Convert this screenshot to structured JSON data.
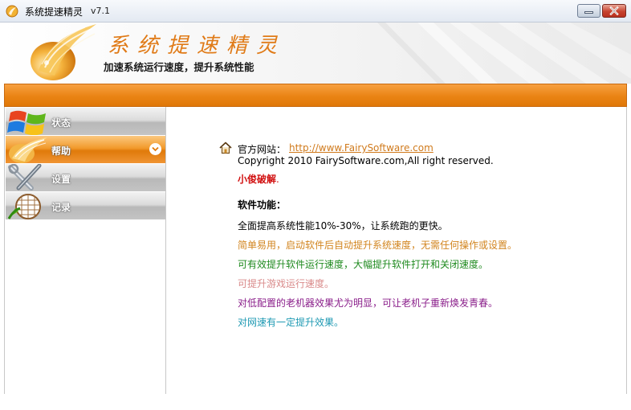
{
  "window": {
    "title": "系统提速精灵",
    "version": "v7.1"
  },
  "banner": {
    "title": "系统提速精灵",
    "subtitle": "加速系统运行速度，提升系统性能"
  },
  "sidebar": {
    "items": [
      {
        "label": "状态",
        "icon": "windows-logo-icon",
        "active": false
      },
      {
        "label": "帮助",
        "icon": "help-flame-icon",
        "active": true
      },
      {
        "label": "设置",
        "icon": "tools-icon",
        "active": false
      },
      {
        "label": "记录",
        "icon": "record-list-icon",
        "active": false
      }
    ]
  },
  "content": {
    "site_label": "官方网站：",
    "site_url": "http://www.FairySoftware.com",
    "copyright": "Copyright 2010 FairySoftware.com,All right reserved.",
    "crack_text": "小俊破解",
    "crack_suffix": ".",
    "features_title": "软件功能：",
    "features": [
      "全面提高系统性能10%-30%，让系统跑的更快。",
      "简单易用，启动软件后自动提升系统速度，无需任何操作或设置。",
      "可有效提升软件运行速度，大幅提升软件打开和关闭速度。",
      "可提升游戏运行速度。",
      "对低配置的老机器效果尤为明显，可让老机子重新焕发青春。",
      "对网速有一定提升效果。"
    ]
  },
  "colors": {
    "accent_orange": "#ea8414",
    "link": "#d07a1c",
    "crack_red": "#d11010"
  }
}
